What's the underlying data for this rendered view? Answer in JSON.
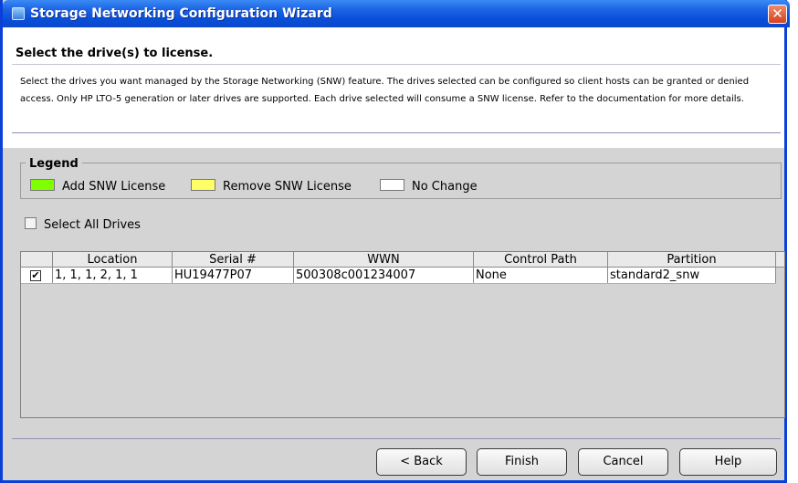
{
  "window": {
    "title": "Storage Networking Configuration Wizard",
    "close_glyph": "✕"
  },
  "header": {
    "title": "Select the drive(s) to license.",
    "description": "Select the drives you want managed by the Storage Networking (SNW) feature. The drives selected can be configured so client hosts can be granted or denied access. Only HP LTO-5 generation or later drives are supported. Each drive selected will consume a SNW license. Refer to the documentation for more details."
  },
  "legend": {
    "title": "Legend",
    "items": [
      {
        "label": "Add SNW License",
        "color": "#7fff00"
      },
      {
        "label": "Remove SNW License",
        "color": "#ffff66"
      },
      {
        "label": "No Change",
        "color": "#ffffff"
      }
    ]
  },
  "select_all": {
    "label": "Select All Drives",
    "checked": false
  },
  "table": {
    "columns": [
      "",
      "Location",
      "Serial #",
      "WWN",
      "Control Path",
      "Partition"
    ],
    "rows": [
      {
        "checked": true,
        "check_glyph": "✔",
        "location": "1, 1, 1, 2, 1, 1",
        "serial": "HU19477P07",
        "wwn": "500308c001234007",
        "control_path": "None",
        "partition": "standard2_snw"
      }
    ]
  },
  "buttons": {
    "back": "< Back",
    "finish": "Finish",
    "cancel": "Cancel",
    "help": "Help"
  }
}
